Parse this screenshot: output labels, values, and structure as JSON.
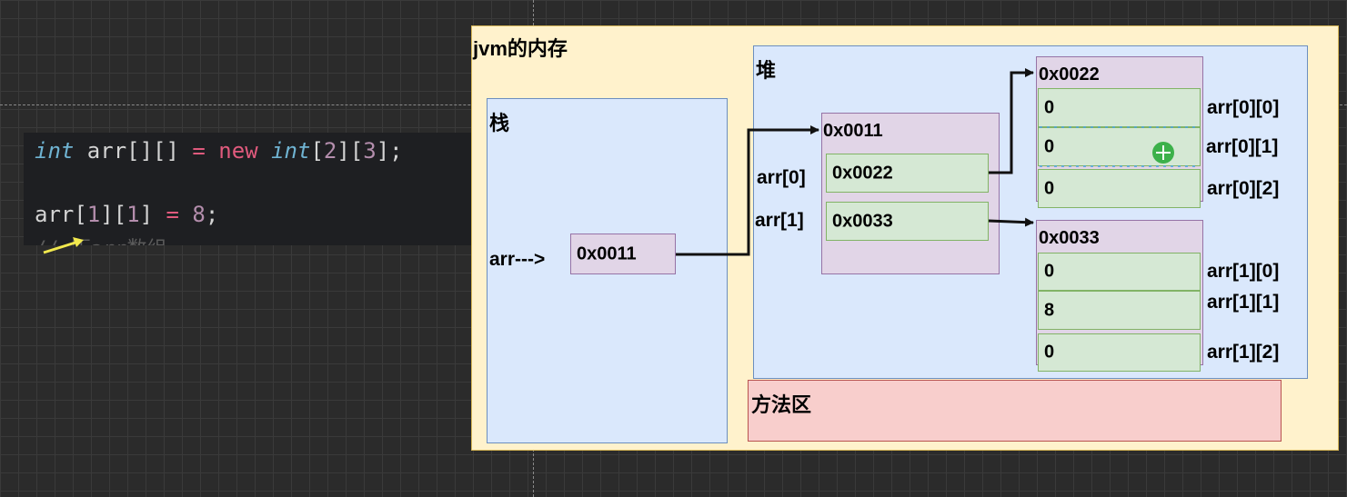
{
  "code": {
    "line1": {
      "t1": "int",
      "t2": " arr[][] ",
      "t3": "=",
      "t4": " new ",
      "t5": "int",
      "t6": "[",
      "t7": "2",
      "t8": "][",
      "t9": "3",
      "t10": "];"
    },
    "line2": {
      "t1": "arr[",
      "t2": "1",
      "t3": "][",
      "t4": "1",
      "t5": "] ",
      "t6": "=",
      "t7": " ",
      "t8": "8",
      "t9": ";"
    },
    "line3": "// 历arr数组"
  },
  "diagram": {
    "jvm_title": "jvm的内存",
    "stack_title": "栈",
    "stack_var": "arr--->",
    "stack_value": "0x0011",
    "heap_title": "堆",
    "method_area_title": "方法区",
    "outer_array": {
      "address": "0x0011",
      "labels": [
        "arr[0]",
        "arr[1]"
      ],
      "values": [
        "0x0022",
        "0x0033"
      ]
    },
    "inner_arrays": [
      {
        "address": "0x0022",
        "values": [
          "0",
          "0",
          "0"
        ],
        "labels": [
          "arr[0][0]",
          "arr[0][1]",
          "arr[0][2]"
        ]
      },
      {
        "address": "0x0033",
        "values": [
          "0",
          "8",
          "0"
        ],
        "labels": [
          "arr[1][0]",
          "arr[1][1]",
          "arr[1][2]"
        ]
      }
    ]
  },
  "colors": {
    "memory_bg": "#fff2cc",
    "stack_bg": "#dae8fc",
    "heap_bg": "#dae8fc",
    "address_box": "#e1d5e7",
    "value_cell": "#d5e8d4",
    "method_area": "#f8cecc",
    "cursor_badge": "#3cb14a",
    "pointer_arrow": "#f2e94e"
  },
  "icons": {
    "cursor": "move-cursor-icon",
    "pointer": "arrow-pointer-icon"
  }
}
